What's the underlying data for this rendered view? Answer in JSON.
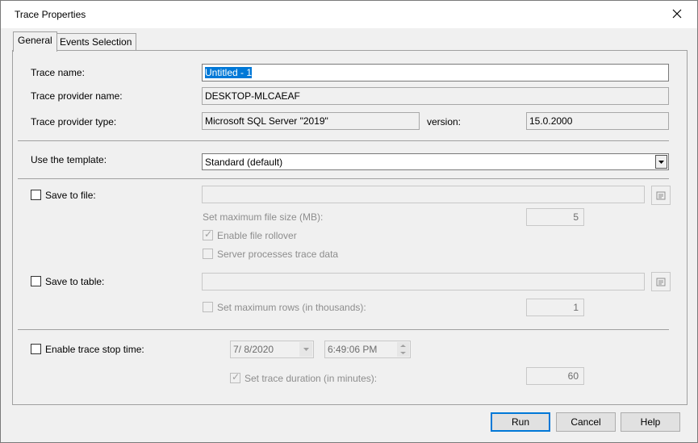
{
  "window": {
    "title": "Trace Properties"
  },
  "tabs": [
    {
      "label": "General",
      "active": true
    },
    {
      "label": "Events Selection",
      "active": false
    }
  ],
  "general": {
    "trace_name_label": "Trace name:",
    "trace_name_value": "Untitled - 1",
    "provider_name_label": "Trace provider name:",
    "provider_name_value": "DESKTOP-MLCAEAF",
    "provider_type_label": "Trace provider type:",
    "provider_type_value": "Microsoft SQL Server \"2019\"",
    "version_label": "version:",
    "version_value": "15.0.2000",
    "template_label": "Use the template:",
    "template_value": "Standard (default)",
    "save_to_file": {
      "label": "Save to file:",
      "checked": false,
      "path": "",
      "max_size_label": "Set maximum file size (MB):",
      "max_size_value": "5",
      "rollover_label": "Enable file rollover",
      "rollover_checked": true,
      "server_processes_label": "Server processes trace data",
      "server_processes_checked": false
    },
    "save_to_table": {
      "label": "Save to table:",
      "checked": false,
      "table": "",
      "max_rows_label": "Set maximum rows (in thousands):",
      "max_rows_checked": false,
      "max_rows_value": "1"
    },
    "stop_time": {
      "label": "Enable trace stop time:",
      "checked": false,
      "date": "7/  8/2020",
      "time": "6:49:06 PM",
      "duration_label": "Set trace duration (in minutes):",
      "duration_checked": true,
      "duration_value": "60"
    }
  },
  "buttons": {
    "run": "Run",
    "cancel": "Cancel",
    "help": "Help"
  },
  "colors": {
    "accent": "#0078d7",
    "dialog_bg": "#f0f0f0",
    "disabled_text": "#8d8d8d"
  }
}
